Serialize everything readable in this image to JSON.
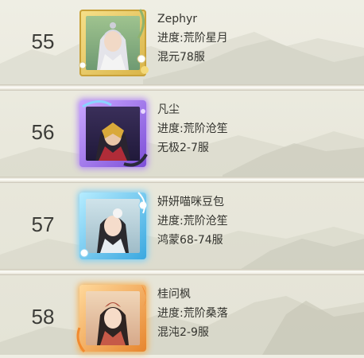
{
  "entries": [
    {
      "rank": "55",
      "name": "Zephyr",
      "progress": "进度:荒阶星月",
      "server": "混元78服",
      "frame_style": "gold",
      "frame_color": "#e6c24a"
    },
    {
      "rank": "56",
      "name": "凡尘",
      "progress": "进度:荒阶沧笙",
      "server": "无极2-7服",
      "frame_style": "purple",
      "frame_color": "#a76ce8"
    },
    {
      "rank": "57",
      "name": "妍妍喵咪豆包",
      "progress": "进度:荒阶沧笙",
      "server": "鸿蒙68-74服",
      "frame_style": "blue",
      "frame_color": "#49b8ea"
    },
    {
      "rank": "58",
      "name": "桂问枫",
      "progress": "进度:荒阶桑落",
      "server": "混沌2-9服",
      "frame_style": "orange",
      "frame_color": "#f0a040"
    }
  ]
}
